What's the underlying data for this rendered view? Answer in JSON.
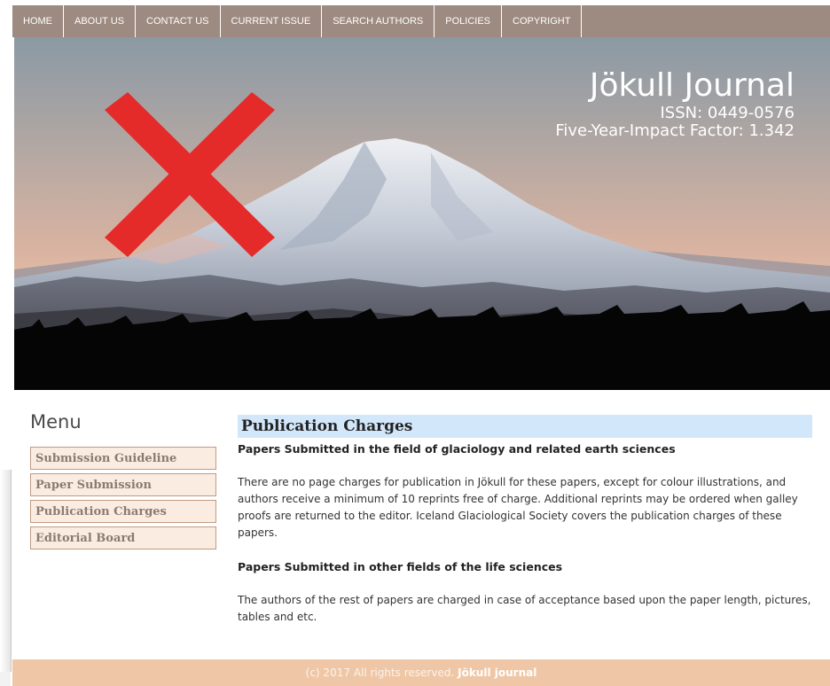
{
  "nav": {
    "items": [
      "HOME",
      "ABOUT US",
      "CONTACT US",
      "CURRENT ISSUE",
      "SEARCH AUTHORS",
      "POLICIES",
      "COPYRIGHT"
    ]
  },
  "banner": {
    "title": "Jökull Journal",
    "issn": "ISSN: 0449-0576",
    "impact": "Five-Year-Impact Factor: 1.342",
    "overlay_mark": "red-x-icon",
    "overlay_color": "#e52a2a"
  },
  "menu": {
    "title": "Menu",
    "items": [
      "Submission Guideline",
      "Paper Submission",
      "Publication Charges",
      "Editorial Board"
    ]
  },
  "content": {
    "title": "Publication Charges",
    "heading1": "Papers Submitted in the field of glaciology and related earth sciences",
    "para1": "There are no page charges for publication in Jökull for these papers, except for colour illustrations, and authors receive a minimum of 10 reprints free of charge. Additional reprints may be ordered when galley proofs are returned to the editor. Iceland Glaciological Society covers the publication charges of these papers.",
    "heading2": "Papers Submitted in other fields of the life sciences",
    "para2": "The authors of the rest of papers are charged in case of acceptance based upon the paper length, pictures, tables and etc."
  },
  "footer": {
    "copyright": "(c) 2017 All rights reserved.",
    "brand": "Jökull journal"
  },
  "colors": {
    "nav_bg": "#9d8a80",
    "menu_bg": "#fbece2",
    "title_bg": "#d3e7fb",
    "footer_bg": "#efc7a6"
  }
}
